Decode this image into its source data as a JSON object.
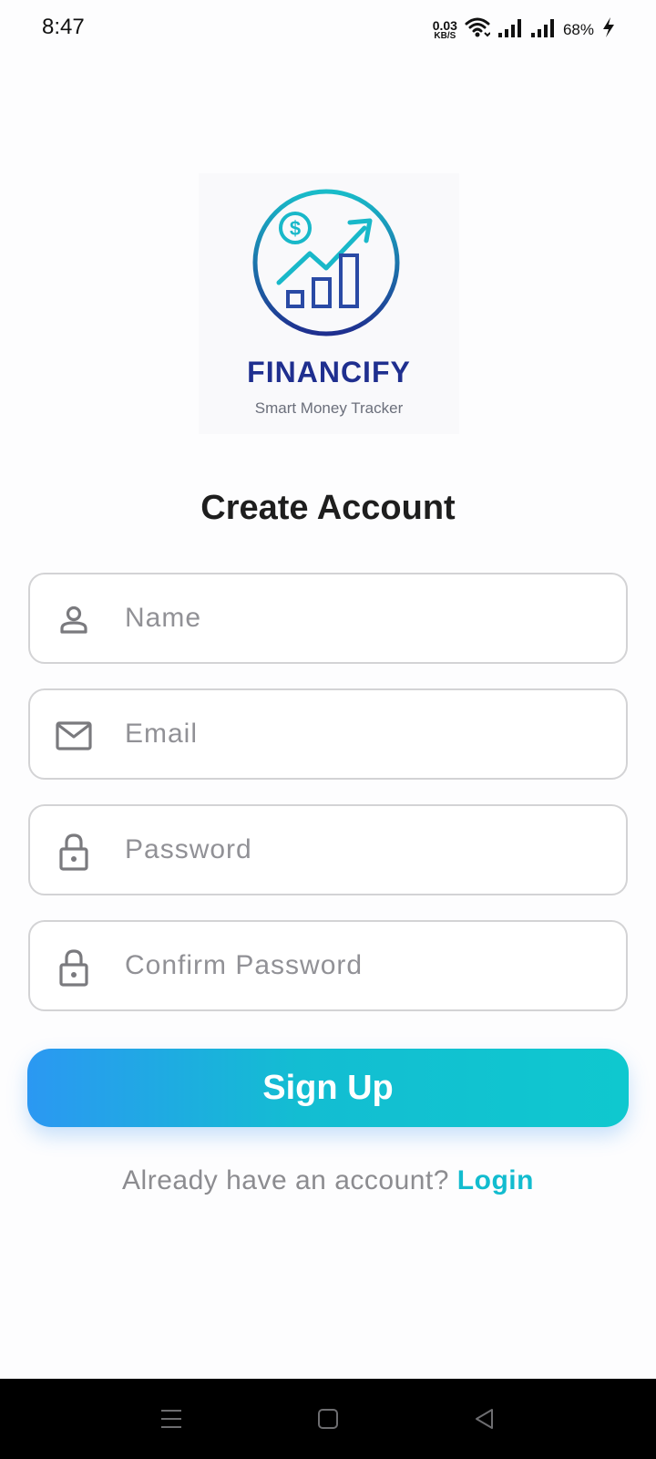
{
  "status_bar": {
    "time": "8:47",
    "net_speed_value": "0.03",
    "net_speed_unit": "KB/S",
    "battery": "68%",
    "icons": [
      "wifi-icon",
      "signal-icon",
      "signal-icon",
      "charging-icon"
    ]
  },
  "logo": {
    "brand_name": "FINANCIFY",
    "tagline": "Smart Money Tracker",
    "colors": {
      "teal": "#19b8c9",
      "navy": "#1f2f8f"
    }
  },
  "page": {
    "title": "Create Account"
  },
  "form": {
    "name": {
      "placeholder": "Name",
      "value": "",
      "icon": "person-icon"
    },
    "email": {
      "placeholder": "Email",
      "value": "",
      "icon": "mail-icon"
    },
    "password": {
      "placeholder": "Password",
      "value": "",
      "icon": "lock-icon"
    },
    "confirm_password": {
      "placeholder": "Confirm Password",
      "value": "",
      "icon": "lock-icon"
    }
  },
  "signup_button": {
    "label": "Sign Up",
    "gradient": [
      "#2b98f2",
      "#0fc8cf"
    ]
  },
  "login_prompt": {
    "text": "Already have an account? ",
    "link": "Login",
    "link_color": "#12bccf"
  },
  "nav_bar": {
    "buttons": [
      "menu-icon",
      "home-icon",
      "back-icon"
    ]
  }
}
